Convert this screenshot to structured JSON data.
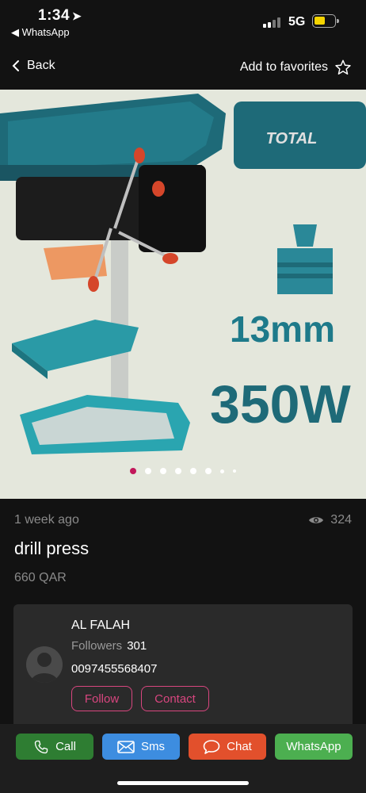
{
  "status": {
    "time": "1:34",
    "back_app": "WhatsApp",
    "network": "5G",
    "battery_color": "#f5d400"
  },
  "nav": {
    "back_label": "Back",
    "favorites_label": "Add to favorites"
  },
  "hero": {
    "brand": "TOTAL",
    "spec_1": "13mm",
    "spec_2": "350W",
    "slides": 8,
    "active_slide": 1
  },
  "listing": {
    "posted": "1 week ago",
    "views": "324",
    "title": "drill press",
    "price": "660 QAR"
  },
  "seller": {
    "name": "AL FALAH",
    "followers_label": "Followers",
    "followers_count": "301",
    "phone": "0097455568407",
    "follow_label": "Follow",
    "contact_label": "Contact",
    "accent": "#d8467f"
  },
  "actions": {
    "call": "Call",
    "sms": "Sms",
    "chat": "Chat",
    "whatsapp": "WhatsApp",
    "colors": {
      "call": "#2e7d32",
      "sms": "#3d8de0",
      "chat": "#e2502c",
      "whatsapp": "#4caf50"
    }
  }
}
